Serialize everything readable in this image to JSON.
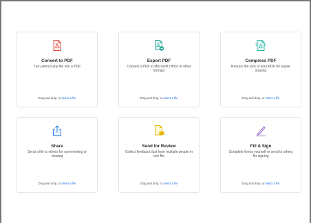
{
  "tools": [
    {
      "name": "convert-to-pdf",
      "title": "Convert to PDF",
      "desc": "Turn almost any file into a PDF",
      "drop": "Drag and drop, or ",
      "link": "select a file",
      "icon": "pdf-file-icon"
    },
    {
      "name": "export-pdf",
      "title": "Export PDF",
      "desc": "Convert a PDF to Microsoft Office or other formats",
      "drop": "Drag and drop, or ",
      "link": "select a file",
      "icon": "export-file-icon"
    },
    {
      "name": "compress-pdf",
      "title": "Compress PDF",
      "desc": "Reduce the size of your PDF for easier sharing",
      "drop": "Drag and drop, or ",
      "link": "select a file",
      "icon": "compress-file-icon"
    },
    {
      "name": "share",
      "title": "Share",
      "desc": "Send a file to others for commenting or viewing",
      "drop": "Drag and drop, or ",
      "link": "select a file",
      "icon": "share-icon"
    },
    {
      "name": "send-for-review",
      "title": "Send for Review",
      "desc": "Collect feedback fast from multiple people in one file",
      "drop": "Drag and drop, or ",
      "link": "select a file",
      "icon": "send-review-icon"
    },
    {
      "name": "fill-sign",
      "title": "Fill & Sign",
      "desc": "Complete forms yourself or send to others for signing",
      "drop": "Drag and drop, or ",
      "link": "select a file",
      "icon": "fill-sign-icon"
    }
  ],
  "colors": {
    "accent_link": "#1473e6",
    "convert": "#e0463a",
    "export": "#26a69a",
    "compress": "#26b5a8",
    "share": "#1473e6",
    "review": "#e6b800",
    "fill_sign": "#8a5cc9"
  }
}
